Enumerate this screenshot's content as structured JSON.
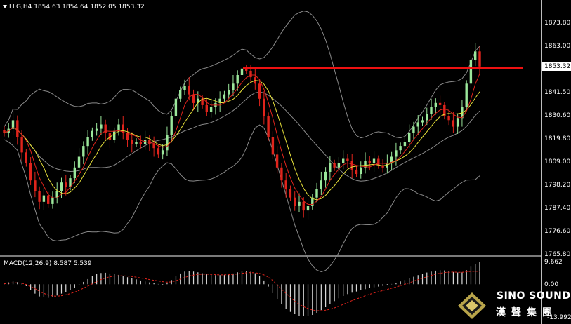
{
  "chart_title": "LLG,H4  1854.63 1854.64 1852.05 1853.32",
  "macd_title": "MACD(12,26,9) 8.587 5.539",
  "current_price": "1853.32",
  "price_axis": [
    "1873.80",
    "1863.00",
    "1852.30",
    "1841.50",
    "1830.60",
    "1819.80",
    "1809.00",
    "1798.20",
    "1787.40",
    "1776.60",
    "1765.80"
  ],
  "macd_axis": [
    "9.662",
    "0.00",
    "-13.992"
  ],
  "logo": {
    "line1": "SINO SOUND",
    "line2": "漢聲集團"
  },
  "colors": {
    "bull": "#9be79b",
    "bear": "#e0241c",
    "ma_yellow": "#e8e23a",
    "ma_red": "#e0241c",
    "band": "#8a8a8a",
    "resistance": "#ee1111"
  },
  "chart_data": {
    "type": "candlestick",
    "symbol": "LLG",
    "timeframe": "H4",
    "ohlc_header": {
      "open": 1854.63,
      "high": 1854.64,
      "low": 1852.05,
      "close": 1853.32
    },
    "ylim": [
      1765.8,
      1873.8
    ],
    "resistance_level": 1852.3,
    "closes": [
      1822,
      1824,
      1828,
      1820,
      1813,
      1808,
      1800,
      1795,
      1790,
      1793,
      1789,
      1792,
      1795,
      1799,
      1797,
      1801,
      1806,
      1811,
      1816,
      1820,
      1823,
      1824,
      1826,
      1822,
      1819,
      1823,
      1826,
      1822,
      1819,
      1817,
      1818,
      1817,
      1819,
      1817,
      1815,
      1812,
      1814,
      1821,
      1830,
      1838,
      1842,
      1844,
      1840,
      1836,
      1838,
      1835,
      1832,
      1834,
      1836,
      1838,
      1840,
      1842,
      1845,
      1849,
      1852,
      1851,
      1848,
      1845,
      1838,
      1830,
      1820,
      1812,
      1806,
      1800,
      1796,
      1792,
      1788,
      1790,
      1786,
      1788,
      1792,
      1796,
      1800,
      1804,
      1808,
      1806,
      1808,
      1810,
      1809,
      1805,
      1803,
      1806,
      1809,
      1808,
      1810,
      1807,
      1806,
      1808,
      1811,
      1814,
      1816,
      1818,
      1822,
      1825,
      1827,
      1828,
      1831,
      1834,
      1836,
      1835,
      1830,
      1828,
      1825,
      1829,
      1834,
      1845,
      1856,
      1860,
      1853
    ],
    "macd_histogram": [
      0.5,
      0.8,
      1.2,
      0.9,
      0.2,
      -0.8,
      -2.5,
      -4,
      -5.2,
      -5.6,
      -5.8,
      -5.4,
      -4.8,
      -4,
      -3.3,
      -2.5,
      -1.6,
      -0.4,
      1,
      2.2,
      3.4,
      4.3,
      4.8,
      4.9,
      4.6,
      4.3,
      4,
      3.5,
      3,
      2.5,
      2.1,
      1.6,
      1.2,
      0.8,
      0.4,
      0.1,
      -0.2,
      0.4,
      1.8,
      3.4,
      4.6,
      5.4,
      5.6,
      5.4,
      5.1,
      4.7,
      4.3,
      4,
      3.9,
      3.9,
      4,
      4.2,
      4.6,
      5.1,
      5.5,
      5.6,
      5.3,
      4.7,
      3.5,
      1.6,
      -1,
      -3.8,
      -6.4,
      -8.5,
      -10.4,
      -11.8,
      -12.8,
      -13.4,
      -13.7,
      -13.6,
      -13.1,
      -12.2,
      -11,
      -9.8,
      -8.4,
      -7.2,
      -6,
      -5,
      -4.2,
      -3.6,
      -3.1,
      -2.6,
      -2.1,
      -1.7,
      -1.3,
      -1,
      -0.7,
      -0.3,
      0.1,
      0.6,
      1.2,
      1.8,
      2.5,
      3.2,
      3.9,
      4.5,
      5,
      5.4,
      5.8,
      6,
      5.9,
      5.6,
      5.2,
      5,
      5.1,
      6,
      7.5,
      8.6,
      9.6
    ],
    "macd_signal": [
      0.2,
      0.4,
      0.6,
      0.6,
      0.4,
      -0.1,
      -0.9,
      -1.9,
      -3,
      -3.9,
      -4.6,
      -5,
      -5.1,
      -4.9,
      -4.5,
      -4,
      -3.4,
      -2.6,
      -1.7,
      -0.8,
      0.2,
      1.1,
      2,
      2.7,
      3.2,
      3.5,
      3.6,
      3.6,
      3.5,
      3.3,
      3,
      2.7,
      2.4,
      2,
      1.7,
      1.4,
      1.1,
      0.9,
      1,
      1.5,
      2.2,
      2.9,
      3.5,
      3.9,
      4.2,
      4.3,
      4.3,
      4.2,
      4.1,
      4,
      4,
      4.1,
      4.2,
      4.4,
      4.7,
      4.9,
      5,
      4.9,
      4.6,
      4,
      3,
      1.6,
      -0.2,
      -2.1,
      -3.9,
      -5.6,
      -7.2,
      -8.5,
      -9.6,
      -10.4,
      -11,
      -11.3,
      -11.3,
      -11.1,
      -10.7,
      -10.1,
      -9.4,
      -8.6,
      -7.8,
      -7,
      -6.3,
      -5.6,
      -4.9,
      -4.3,
      -3.7,
      -3.2,
      -2.7,
      -2.2,
      -1.7,
      -1.2,
      -0.6,
      0,
      0.6,
      1.3,
      2,
      2.6,
      3.2,
      3.8,
      4.3,
      4.7,
      5,
      5.1,
      5.2,
      5.1,
      5.1,
      5.3,
      5.5,
      5.5,
      5.5
    ]
  }
}
